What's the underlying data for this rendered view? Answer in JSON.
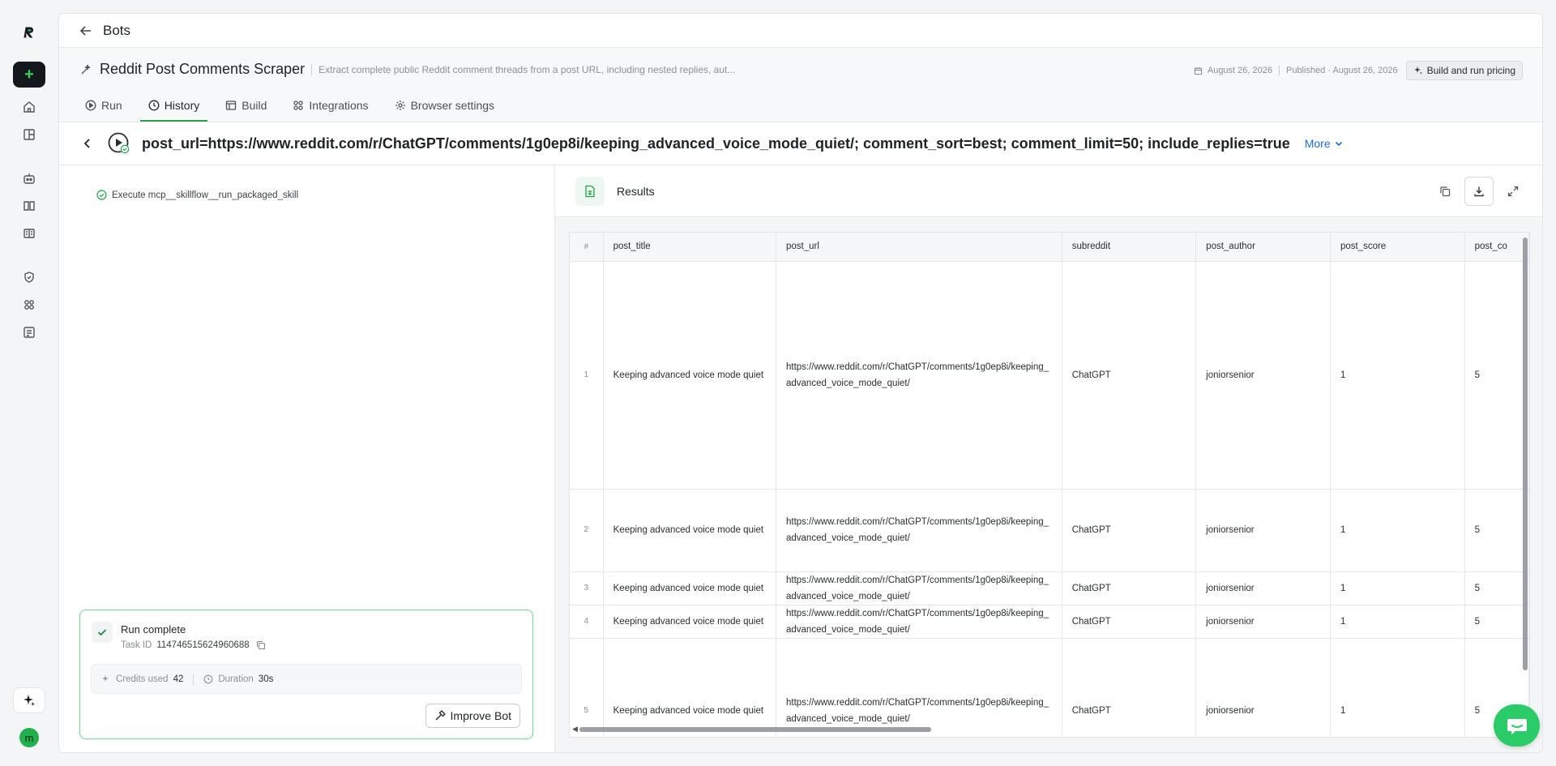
{
  "nav": {
    "back_label": "Bots"
  },
  "bot": {
    "name": "Reddit Post Comments Scraper",
    "description": "Extract complete public Reddit comment threads from a post URL, including nested replies, aut...",
    "updated": "August 26, 2026",
    "published": "Published · August 26, 2026",
    "pricing_button": "Build and run pricing"
  },
  "tabs": [
    {
      "label": "Run",
      "icon": "play-icon"
    },
    {
      "label": "History",
      "icon": "clock-icon",
      "active": true
    },
    {
      "label": "Build",
      "icon": "build-icon"
    },
    {
      "label": "Integrations",
      "icon": "integrations-icon"
    },
    {
      "label": "Browser settings",
      "icon": "settings-icon"
    }
  ],
  "run": {
    "title": "post_url=https://www.reddit.com/r/ChatGPT/comments/1g0ep8i/keeping_advanced_voice_mode_quiet/; comment_sort=best; comment_limit=50; include_replies=true",
    "more_label": "More"
  },
  "steps": [
    {
      "label": "Execute mcp__skillflow__run_packaged_skill"
    }
  ],
  "run_card": {
    "status": "Run complete",
    "task_id_label": "Task ID",
    "task_id": "114746515624960688",
    "credits_label": "Credits used",
    "credits": "42",
    "duration_label": "Duration",
    "duration": "30s",
    "improve_button": "Improve Bot"
  },
  "results": {
    "label": "Results",
    "columns": [
      "#",
      "post_title",
      "post_url",
      "subreddit",
      "post_author",
      "post_score",
      "post_co"
    ],
    "rows": [
      {
        "n": "1",
        "post_title": "Keeping advanced voice mode quiet",
        "post_url": "https://www.reddit.com/r/ChatGPT/comments/1g0ep8i/keeping_advanced_voice_mode_quiet/",
        "subreddit": "ChatGPT",
        "post_author": "joniorsenior",
        "post_score": "1",
        "post_co": "5"
      },
      {
        "n": "2",
        "post_title": "Keeping advanced voice mode quiet",
        "post_url": "https://www.reddit.com/r/ChatGPT/comments/1g0ep8i/keeping_advanced_voice_mode_quiet/",
        "subreddit": "ChatGPT",
        "post_author": "joniorsenior",
        "post_score": "1",
        "post_co": "5"
      },
      {
        "n": "3",
        "post_title": "Keeping advanced voice mode quiet",
        "post_url": "https://www.reddit.com/r/ChatGPT/comments/1g0ep8i/keeping_advanced_voice_mode_quiet/",
        "subreddit": "ChatGPT",
        "post_author": "joniorsenior",
        "post_score": "1",
        "post_co": "5"
      },
      {
        "n": "4",
        "post_title": "Keeping advanced voice mode quiet",
        "post_url": "https://www.reddit.com/r/ChatGPT/comments/1g0ep8i/keeping_advanced_voice_mode_quiet/",
        "subreddit": "ChatGPT",
        "post_author": "joniorsenior",
        "post_score": "1",
        "post_co": "5"
      },
      {
        "n": "5",
        "post_title": "Keeping advanced voice mode quiet",
        "post_url": "https://www.reddit.com/r/ChatGPT/comments/1g0ep8i/keeping_advanced_voice_mode_quiet/",
        "subreddit": "ChatGPT",
        "post_author": "joniorsenior",
        "post_score": "1",
        "post_co": "5"
      }
    ]
  },
  "sidebar": {
    "avatar_initial": "m",
    "icons": [
      "home-icon",
      "dashboard-icon",
      "bot-icon",
      "book-icon",
      "library-icon",
      "shield-icon",
      "apps-icon",
      "logs-icon"
    ]
  },
  "colors": {
    "accent": "#22a447",
    "brand_dark": "#14181d",
    "link": "#1d6ed8",
    "chat_fab": "#2bcb68"
  }
}
